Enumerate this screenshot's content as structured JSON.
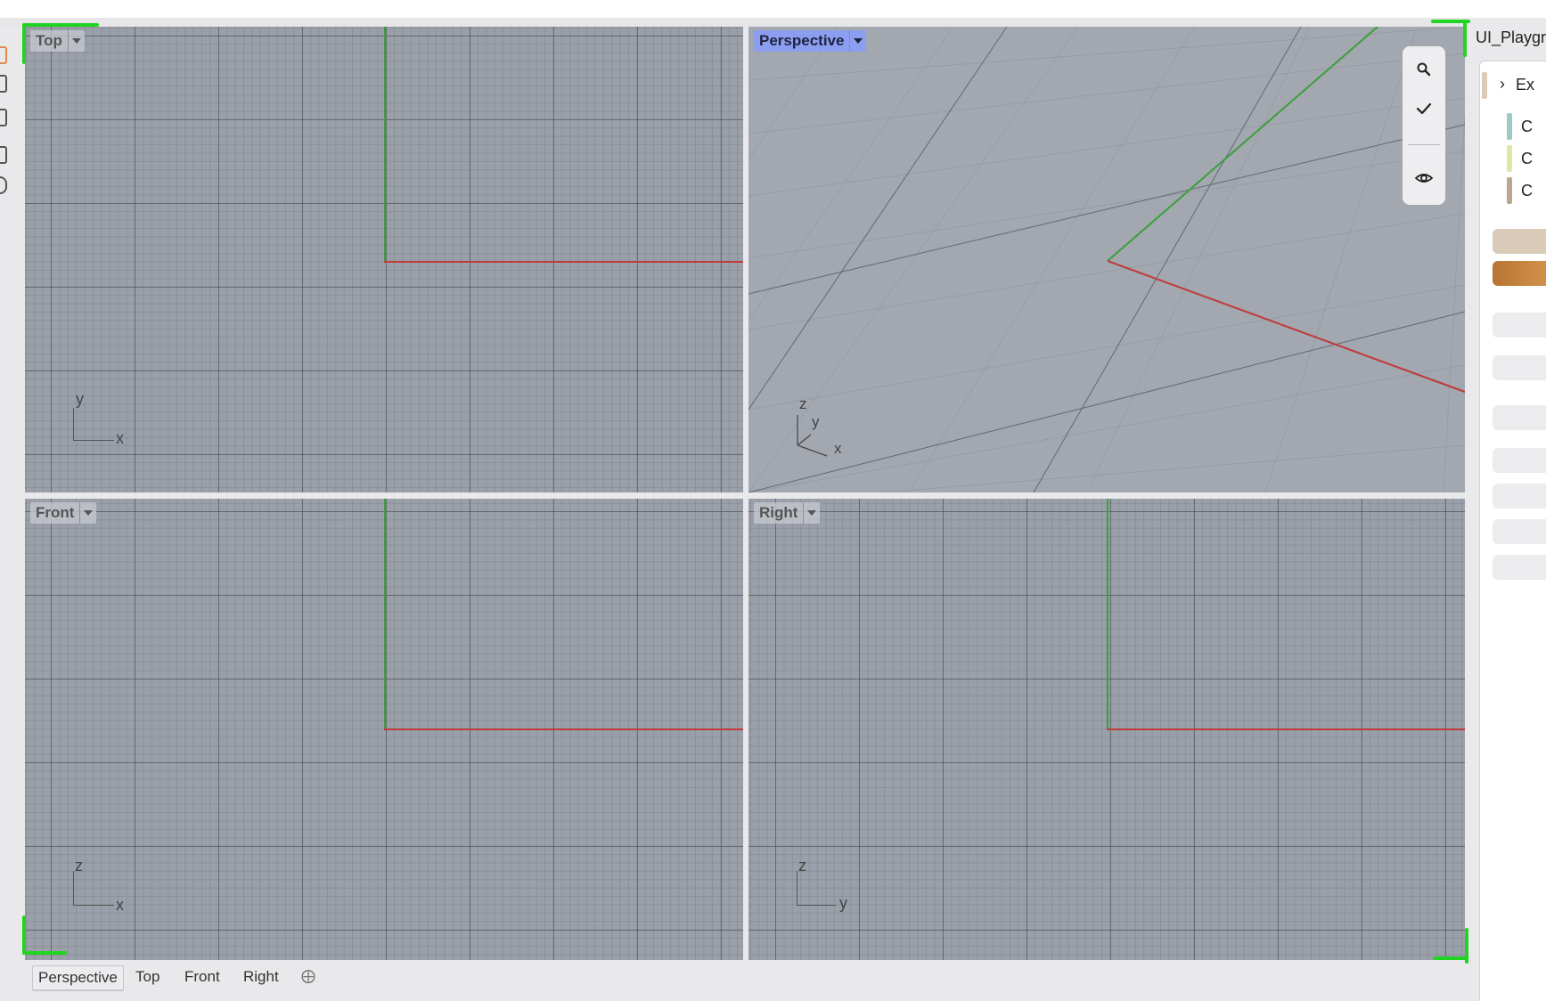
{
  "viewports": {
    "top": {
      "label": "Top",
      "axis_a": "y",
      "axis_b": "x"
    },
    "perspective": {
      "label": "Perspective",
      "axis_z": "z",
      "axis_y": "y",
      "axis_x": "x"
    },
    "front": {
      "label": "Front",
      "axis_a": "z",
      "axis_b": "x"
    },
    "right": {
      "label": "Right",
      "axis_a": "z",
      "axis_b": "y"
    }
  },
  "tabs": [
    "Perspective",
    "Top",
    "Front",
    "Right"
  ],
  "active_tab": "Perspective",
  "nav_tools": [
    "search-icon",
    "check-icon",
    "eye-icon"
  ],
  "right_panel": {
    "title": "UI_Playgro",
    "section_label": "Ex",
    "rows": [
      "C",
      "C",
      "C"
    ],
    "row_colors": [
      "#9fc9c6",
      "#dfe8a8",
      "#b9a88f"
    ]
  },
  "colors": {
    "viewport_bg": "#9aa0a9",
    "active_label": "#8c9ef0",
    "x_axis": "#c03a3a",
    "y_axis": "#3aa03a",
    "accent_tan": "#d9cbb8",
    "accent_brown": "#c28036"
  }
}
